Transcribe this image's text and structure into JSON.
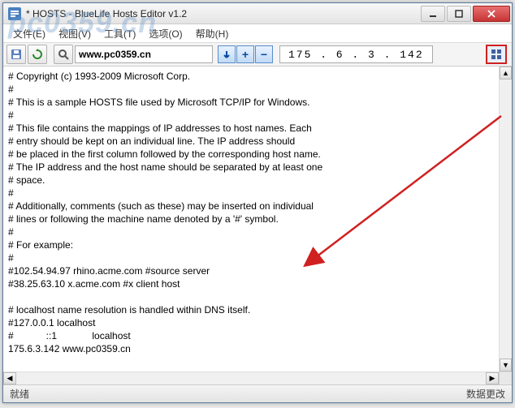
{
  "titlebar": {
    "title": "* HOSTS - BlueLife Hosts Editor v1.2"
  },
  "menu": {
    "file": "文件(E)",
    "view": "视图(V)",
    "tools": "工具(T)",
    "options": "选项(O)",
    "help": "帮助(H)"
  },
  "toolbar": {
    "domain_value": "www.pc0359.cn",
    "ip_value": "175 .  6  .  3 . 142"
  },
  "hosts_text": "# Copyright (c) 1993-2009 Microsoft Corp.\n#\n# This is a sample HOSTS file used by Microsoft TCP/IP for Windows.\n#\n# This file contains the mappings of IP addresses to host names. Each\n# entry should be kept on an individual line. The IP address should\n# be placed in the first column followed by the corresponding host name.\n# The IP address and the host name should be separated by at least one\n# space.\n#\n# Additionally, comments (such as these) may be inserted on individual\n# lines or following the machine name denoted by a '#' symbol.\n#\n# For example:\n#\n#102.54.94.97 rhino.acme.com #source server\n#38.25.63.10 x.acme.com #x client host\n\n# localhost name resolution is handled within DNS itself.\n#127.0.0.1 localhost\n#            ::1             localhost\n175.6.3.142 www.pc0359.cn",
  "statusbar": {
    "left": "就绪",
    "right": "数据更改"
  },
  "watermark": "pc0359.cn"
}
